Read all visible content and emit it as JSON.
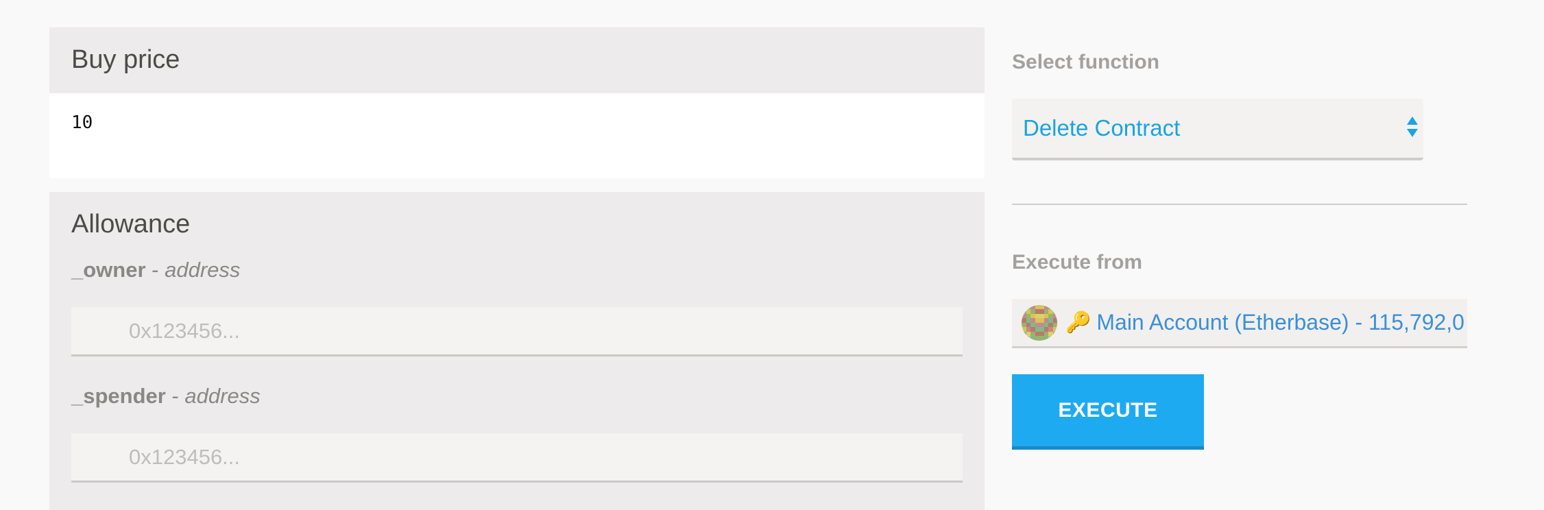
{
  "inputs_panel": {
    "buy_price": {
      "title": "Buy price",
      "value": "10"
    },
    "allowance": {
      "title": "Allowance",
      "params": [
        {
          "name": "_owner",
          "separator": " - ",
          "type": "address",
          "placeholder": "0x123456..."
        },
        {
          "name": "_spender",
          "separator": " - ",
          "type": "address",
          "placeholder": "0x123456..."
        }
      ]
    }
  },
  "function_select": {
    "label": "Select function",
    "selected": "Delete Contract"
  },
  "execute_from": {
    "label": "Execute from",
    "account": "Main Account (Etherbase) - 115,792,0",
    "key_icon": "key-icon",
    "avatar_icon": "identicon"
  },
  "execute_button": {
    "label": "EXECUTE"
  },
  "colors": {
    "accent": "#1eaaf1",
    "link": "#3a8fd9",
    "panel_bg": "#edebeb"
  }
}
